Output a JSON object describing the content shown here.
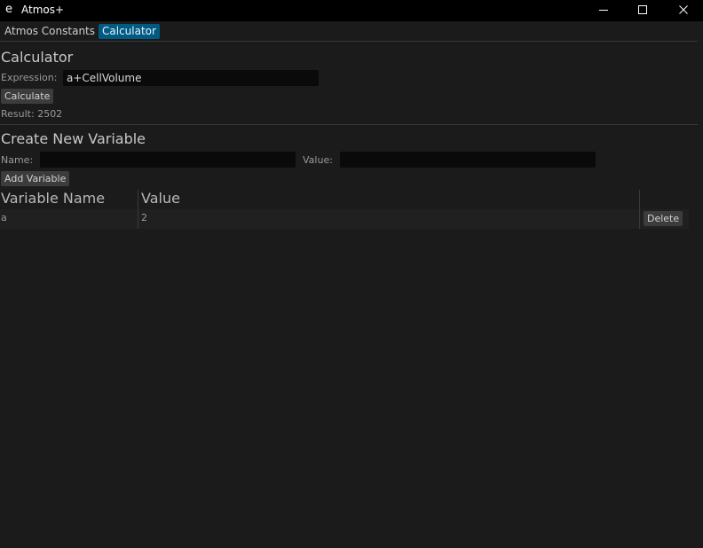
{
  "window": {
    "icon_glyph": "e",
    "title": "Atmos+",
    "controls": {
      "minimize_icon": "minimize-icon",
      "maximize_icon": "maximize-icon",
      "close_icon": "close-icon"
    }
  },
  "menu": {
    "tabs": [
      {
        "label": "Atmos Constants",
        "active": false
      },
      {
        "label": "Calculator",
        "active": true
      }
    ],
    "active_color": "#005a82"
  },
  "calculator": {
    "heading": "Calculator",
    "expression_label": "Expression:",
    "expression_value": "a+CellVolume",
    "calculate_label": "Calculate",
    "result_text": "Result: 2502"
  },
  "create_variable": {
    "heading": "Create New Variable",
    "name_label": "Name:",
    "name_value": "",
    "value_label": "Value:",
    "value_value": "",
    "add_label": "Add Variable"
  },
  "variables_table": {
    "columns": [
      "Variable Name",
      "Value"
    ],
    "rows": [
      {
        "name": "a",
        "value": "2",
        "delete_label": "Delete"
      }
    ]
  }
}
